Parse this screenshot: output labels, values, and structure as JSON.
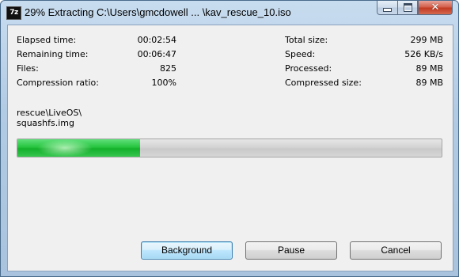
{
  "window": {
    "app_icon": "7z",
    "title": "29% Extracting C:\\Users\\gmcdowell ... \\kav_rescue_10.iso",
    "caption_buttons": {
      "minimize": "minimize-icon",
      "maximize": "maximize-icon",
      "close": "✕"
    }
  },
  "stats": {
    "left": [
      {
        "label": "Elapsed time:",
        "value": "00:02:54"
      },
      {
        "label": "Remaining time:",
        "value": "00:06:47"
      },
      {
        "label": "Files:",
        "value": "825"
      },
      {
        "label": "Compression ratio:",
        "value": "100%"
      }
    ],
    "right": [
      {
        "label": "Total size:",
        "value": "299 MB"
      },
      {
        "label": "Speed:",
        "value": "526 KB/s"
      },
      {
        "label": "Processed:",
        "value": "89 MB"
      },
      {
        "label": "Compressed size:",
        "value": "89 MB"
      }
    ]
  },
  "current_file": {
    "folder": "rescue\\LiveOS\\",
    "name": "squashfs.img"
  },
  "progress": {
    "fraction": 0.29,
    "fill_color": "#1fbf38"
  },
  "buttons": {
    "background": "Background",
    "pause": "Pause",
    "cancel": "Cancel"
  }
}
